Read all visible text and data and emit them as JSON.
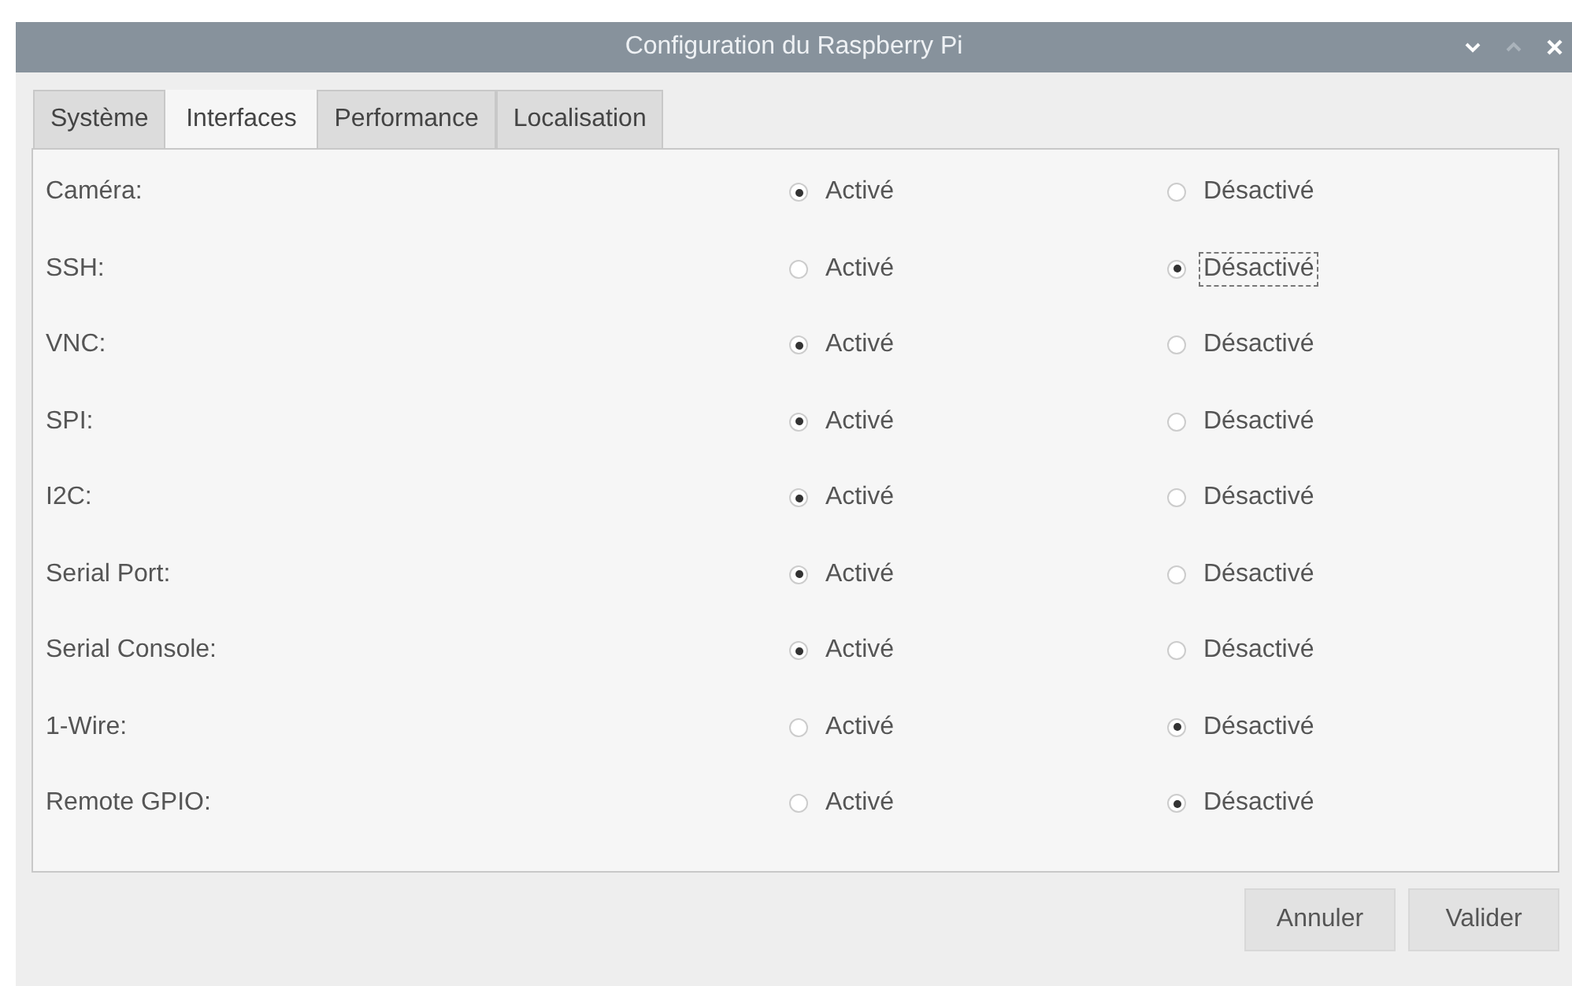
{
  "window": {
    "title": "Configuration du Raspberry Pi"
  },
  "tabs": [
    {
      "label": "Système",
      "selected": false
    },
    {
      "label": "Interfaces",
      "selected": true
    },
    {
      "label": "Performance",
      "selected": false
    },
    {
      "label": "Localisation",
      "selected": false
    }
  ],
  "settings": [
    {
      "name": "Caméra:",
      "options": [
        {
          "label": "Activé",
          "selected": true,
          "focused": false
        },
        {
          "label": "Désactivé",
          "selected": false,
          "focused": false
        }
      ]
    },
    {
      "name": "SSH:",
      "options": [
        {
          "label": "Activé",
          "selected": false,
          "focused": false
        },
        {
          "label": "Désactivé",
          "selected": true,
          "focused": true
        }
      ]
    },
    {
      "name": "VNC:",
      "options": [
        {
          "label": "Activé",
          "selected": true,
          "focused": false
        },
        {
          "label": "Désactivé",
          "selected": false,
          "focused": false
        }
      ]
    },
    {
      "name": "SPI:",
      "options": [
        {
          "label": "Activé",
          "selected": true,
          "focused": false
        },
        {
          "label": "Désactivé",
          "selected": false,
          "focused": false
        }
      ]
    },
    {
      "name": "I2C:",
      "options": [
        {
          "label": "Activé",
          "selected": true,
          "focused": false
        },
        {
          "label": "Désactivé",
          "selected": false,
          "focused": false
        }
      ]
    },
    {
      "name": "Serial Port:",
      "options": [
        {
          "label": "Activé",
          "selected": true,
          "focused": false
        },
        {
          "label": "Désactivé",
          "selected": false,
          "focused": false
        }
      ]
    },
    {
      "name": "Serial Console:",
      "options": [
        {
          "label": "Activé",
          "selected": true,
          "focused": false
        },
        {
          "label": "Désactivé",
          "selected": false,
          "focused": false
        }
      ]
    },
    {
      "name": "1-Wire:",
      "options": [
        {
          "label": "Activé",
          "selected": false,
          "focused": false
        },
        {
          "label": "Désactivé",
          "selected": true,
          "focused": false
        }
      ]
    },
    {
      "name": "Remote GPIO:",
      "options": [
        {
          "label": "Activé",
          "selected": false,
          "focused": false
        },
        {
          "label": "Désactivé",
          "selected": true,
          "focused": false
        }
      ]
    }
  ],
  "buttons": [
    "Annuler",
    "Valider"
  ]
}
